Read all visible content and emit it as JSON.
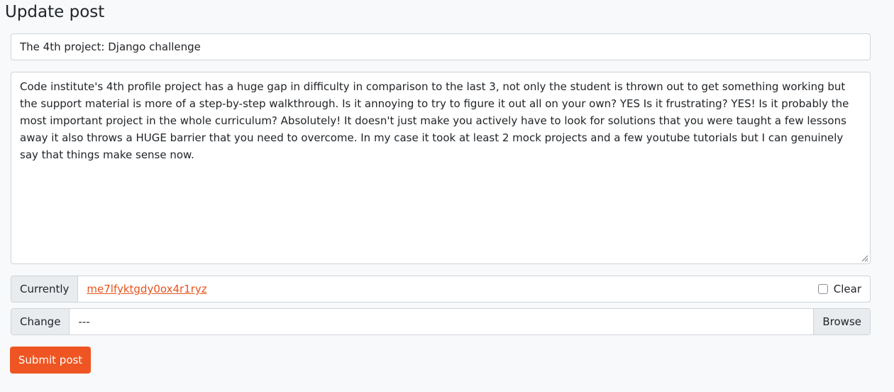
{
  "page": {
    "heading": "Update post"
  },
  "form": {
    "title_value": "The 4th project: Django challenge",
    "content_value": "Code institute's 4th profile project has a huge gap in difficulty in comparison to the last 3, not only the student is thrown out to get something working but the support material is more of a step-by-step walkthrough. Is it annoying to try to figure it out all on your own? YES Is it frustrating? YES! Is it probably the most important project in the whole curriculum? Absolutely! It doesn't just make you actively have to look for solutions that you were taught a few lessons away it also throws a HUGE barrier that you need to overcome. In my case it took at least 2 mock projects and a few youtube tutorials but I can genuinely say that things make sense now.",
    "image": {
      "currently_label": "Currently",
      "current_file": "me7lfyktgdy0ox4r1ryz",
      "clear_label": "Clear",
      "change_label": "Change",
      "selected_file": "---",
      "browse_label": "Browse"
    },
    "submit_label": "Submit post"
  },
  "colors": {
    "accent": "#ee5522",
    "link": "#e8531e",
    "background": "#f8f9fa"
  }
}
